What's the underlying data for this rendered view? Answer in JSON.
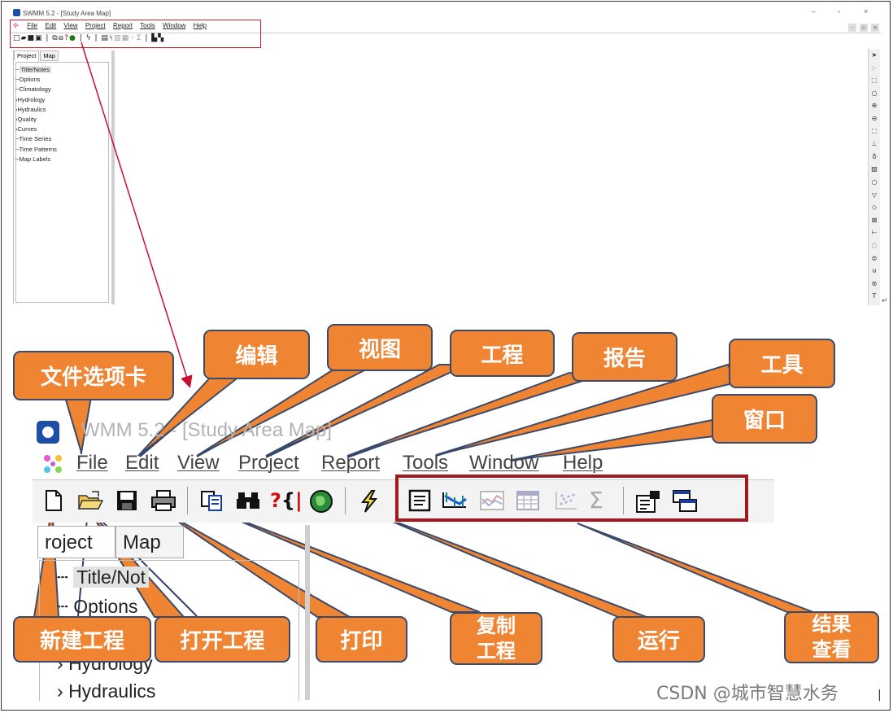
{
  "app": {
    "title": "SWMM 5.2 - [Study Area Map]",
    "zoomed_title": "WMM 5.2 - [Study Area Map]"
  },
  "menu": [
    "File",
    "Edit",
    "View",
    "Project",
    "Report",
    "Tools",
    "Window",
    "Help"
  ],
  "window_controls": {
    "minimize": "–",
    "restore": "▫",
    "close": "×"
  },
  "mdi_controls": [
    "-",
    "▫",
    "×"
  ],
  "panel": {
    "tabs": [
      "Project",
      "Map"
    ],
    "zoomed_tabs": [
      "roject",
      "Map"
    ],
    "tree": [
      "Title/Notes",
      "Options",
      "Climatology",
      "Hydrology",
      "Hydraulics",
      "Quality",
      "Curves",
      "Time Series",
      "Time Patterns",
      "Map Labels"
    ],
    "zoomed_tree": [
      "Title/Not",
      "Options",
      "Hydrology",
      "Hydraulics"
    ]
  },
  "toolbar_icons": [
    {
      "name": "new-icon",
      "glyph": "🗋"
    },
    {
      "name": "open-icon",
      "glyph": "📂"
    },
    {
      "name": "save-icon",
      "glyph": "💾"
    },
    {
      "name": "print-icon",
      "glyph": "🖶"
    },
    {
      "name": "copy-icon",
      "glyph": "⧉"
    },
    {
      "name": "find-icon",
      "glyph": "🔭"
    },
    {
      "name": "query-icon",
      "glyph": "?{}"
    },
    {
      "name": "globe-icon",
      "glyph": "🌐"
    },
    {
      "name": "run-icon",
      "glyph": "⚡"
    },
    {
      "name": "status-report-icon",
      "glyph": "▤"
    },
    {
      "name": "profile-plot-icon",
      "glyph": "⫽"
    },
    {
      "name": "time-series-plot-icon",
      "glyph": "≋"
    },
    {
      "name": "table-icon",
      "glyph": "▦"
    },
    {
      "name": "scatter-plot-icon",
      "glyph": "⁘"
    },
    {
      "name": "statistics-icon",
      "glyph": "Σ"
    },
    {
      "name": "options-icon",
      "glyph": "⚙"
    },
    {
      "name": "arrange-windows-icon",
      "glyph": "⧉"
    }
  ],
  "callouts": {
    "file_tab": "文件选项卡",
    "edit": "编辑",
    "view": "视图",
    "project": "工程",
    "report": "报告",
    "tools": "工具",
    "window": "窗口",
    "new_project": "新建工程",
    "open_project": "打开工程",
    "print": "打印",
    "copy_project": "复制\n工程",
    "run": "运行",
    "view_results": "结果\n查看"
  },
  "watermark": "CSDN @城市智慧水务",
  "colors": {
    "callout_fill": "#ef8432",
    "callout_border": "#3a4a6b",
    "highlight_red": "#a3181e",
    "arrow_red": "#c8102e"
  }
}
